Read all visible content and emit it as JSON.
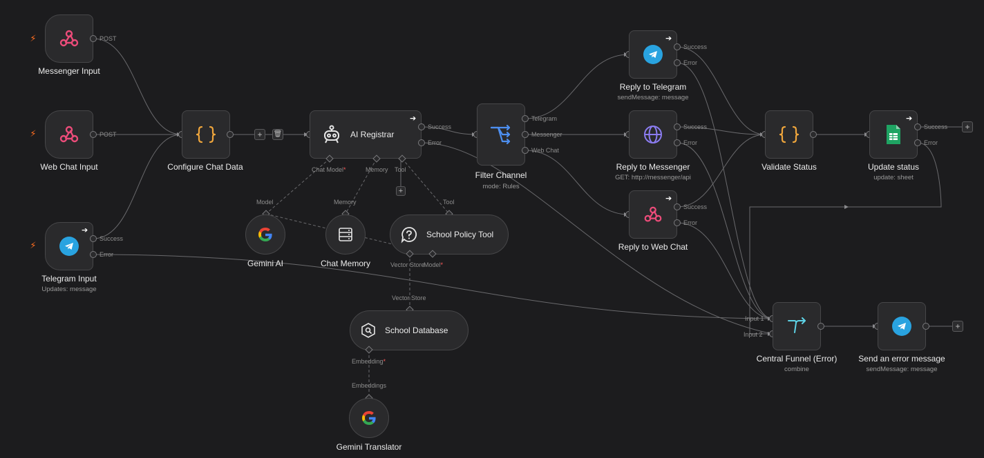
{
  "nodes": {
    "messenger_input": {
      "title": "Messenger Input",
      "port": "POST"
    },
    "webchat_input": {
      "title": "Web Chat Input",
      "port": "POST"
    },
    "telegram_input": {
      "title": "Telegram Input",
      "subtitle": "Updates: message",
      "ports": [
        "Success",
        "Error"
      ]
    },
    "configure_chat": {
      "title": "Configure Chat Data"
    },
    "ai_registrar": {
      "title": "AI Registrar",
      "ports": [
        "Success",
        "Error"
      ],
      "sub_ports": {
        "chat_model": "Chat Model",
        "memory": "Memory",
        "tool": "Tool"
      }
    },
    "filter_channel": {
      "title": "Filter Channel",
      "subtitle": "mode: Rules",
      "ports": [
        "Telegram",
        "Messenger",
        "Web Chat"
      ]
    },
    "reply_telegram": {
      "title": "Reply to Telegram",
      "subtitle": "sendMessage: message",
      "ports": [
        "Success",
        "Error"
      ]
    },
    "reply_messenger": {
      "title": "Reply to Messenger",
      "subtitle": "GET: http://messenger/api",
      "ports": [
        "Success",
        "Error"
      ]
    },
    "reply_webchat": {
      "title": "Reply to Web Chat",
      "ports": [
        "Success",
        "Error"
      ]
    },
    "validate_status": {
      "title": "Validate Status"
    },
    "update_status": {
      "title": "Update status",
      "subtitle": "update: sheet",
      "ports": [
        "Success",
        "Error"
      ]
    },
    "gemini_ai": {
      "title": "Gemini AI",
      "top_port": "Model"
    },
    "chat_memory": {
      "title": "Chat Memory",
      "top_port": "Memory"
    },
    "school_policy": {
      "title": "School Policy Tool",
      "top_port": "Tool",
      "sub_ports": {
        "vector_store": "Vector Store",
        "model": "Model"
      }
    },
    "school_database": {
      "title": "School Database",
      "top_port": "Vector Store",
      "sub_port": "Embedding"
    },
    "gemini_translator": {
      "title": "Gemini Translator",
      "top_port": "Embeddings"
    },
    "central_funnel": {
      "title": "Central Funnel (Error)",
      "subtitle": "combine",
      "ports": [
        "Input 1",
        "Input 2"
      ]
    },
    "send_error": {
      "title": "Send an error message",
      "subtitle": "sendMessage: message"
    }
  },
  "icons": {
    "webhook": "webhook-icon",
    "telegram": "telegram-icon",
    "code": "code-braces-icon",
    "robot": "robot-icon",
    "filter": "filter-route-icon",
    "globe": "globe-icon",
    "sheets": "google-sheets-icon",
    "google": "google-g-icon",
    "memory": "database-icon",
    "tool": "question-icon",
    "vector": "vector-search-icon",
    "merge": "merge-icon"
  },
  "colors": {
    "background": "#1c1c1e",
    "node": "#2a2a2c",
    "webhook": "#ec4c7a",
    "telegram": "#29a3e0",
    "code": "#f0a63c",
    "filter": "#4d8ff0",
    "globe": "#8b7cf0",
    "sheets": "#1fa463",
    "merge": "#5ed3e6",
    "trigger_bolt": "#ff6d1f"
  }
}
